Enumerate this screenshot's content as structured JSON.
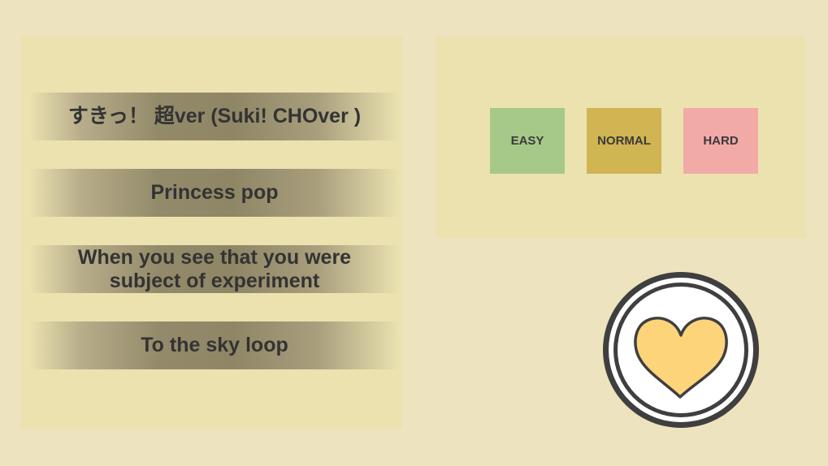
{
  "songs": [
    {
      "title": "すきっ！ 超ver  (Suki!  CHOver )"
    },
    {
      "title": "Princess pop"
    },
    {
      "title": "When you see that you were",
      "title_line2": "subject of experiment"
    },
    {
      "title": "To the sky loop"
    }
  ],
  "difficulty": {
    "easy": "EASY",
    "normal": "NORMAL",
    "hard": "HARD"
  },
  "colors": {
    "background": "#ede3be",
    "panel": "#ebe2b0",
    "easy": "#a6c98a",
    "normal": "#d1b553",
    "hard": "#f2aaa7",
    "heart": "#fed47a"
  },
  "icons": {
    "start": "heart-icon"
  }
}
